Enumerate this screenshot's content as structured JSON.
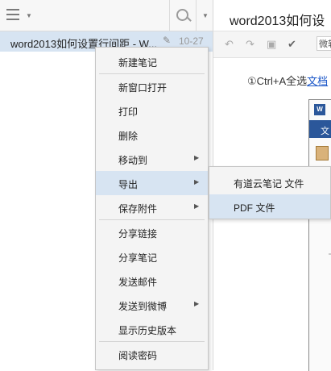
{
  "search": {
    "placeholder": ""
  },
  "note_list": {
    "items": [
      {
        "title": "word2013如何设置行间距 - W...",
        "date": "10-27",
        "selected": true
      }
    ]
  },
  "editor": {
    "doc_title": "word2013如何设",
    "font_select_value": "微软",
    "body_prefix": "①Ctrl+A全选",
    "body_link": "文档",
    "embedded": {
      "logo_text": "W",
      "ribbon_tab": "文"
    }
  },
  "context_menu": {
    "new_note": "新建笔记",
    "open_new_window": "新窗口打开",
    "print": "打印",
    "delete": "删除",
    "move_to": "移动到",
    "export": "导出",
    "save_attachment": "保存附件",
    "share_link": "分享链接",
    "share_note": "分享笔记",
    "send_email": "发送邮件",
    "send_weibo": "发送到微博",
    "show_history": "显示历史版本",
    "read_password": "阅读密码"
  },
  "export_submenu": {
    "youdao_file": "有道云笔记 文件",
    "pdf_file": "PDF 文件"
  },
  "colors": {
    "highlight": "#d7e4f2",
    "menu_bg": "#f4f4f4",
    "link": "#1a56c8"
  }
}
